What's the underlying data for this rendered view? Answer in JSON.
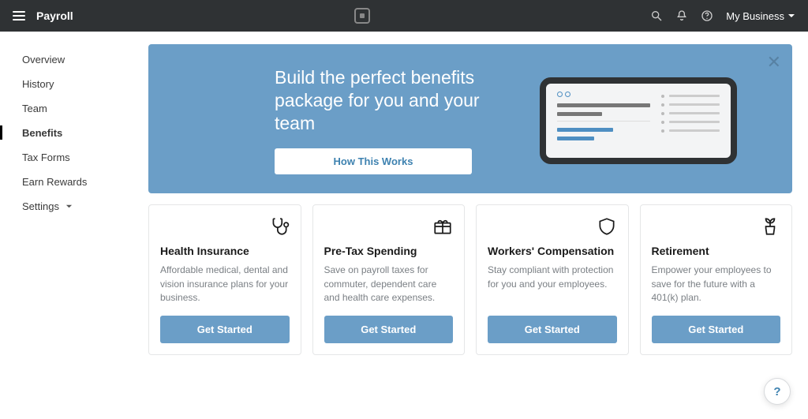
{
  "topbar": {
    "app_title": "Payroll",
    "business_menu_label": "My Business"
  },
  "sidebar": {
    "items": [
      {
        "label": "Overview",
        "active": false
      },
      {
        "label": "History",
        "active": false
      },
      {
        "label": "Team",
        "active": false
      },
      {
        "label": "Benefits",
        "active": true
      },
      {
        "label": "Tax Forms",
        "active": false
      },
      {
        "label": "Earn Rewards",
        "active": false
      },
      {
        "label": "Settings",
        "active": false,
        "has_submenu": true
      }
    ]
  },
  "hero": {
    "headline": "Build the perfect benefits package for you and your team",
    "cta_label": "How This Works"
  },
  "cards": [
    {
      "title": "Health Insurance",
      "desc": "Affordable medical, dental and vision insurance plans for your business.",
      "cta": "Get Started",
      "icon": "stethoscope"
    },
    {
      "title": "Pre-Tax Spending",
      "desc": "Save on payroll taxes for commuter, dependent care and health care expenses.",
      "cta": "Get Started",
      "icon": "gift"
    },
    {
      "title": "Workers' Compensation",
      "desc": "Stay compliant with protection for you and your employees.",
      "cta": "Get Started",
      "icon": "shield"
    },
    {
      "title": "Retirement",
      "desc": "Empower your employees to save for the future with a 401(k) plan.",
      "cta": "Get Started",
      "icon": "plant"
    }
  ],
  "help": {
    "label": "?"
  }
}
